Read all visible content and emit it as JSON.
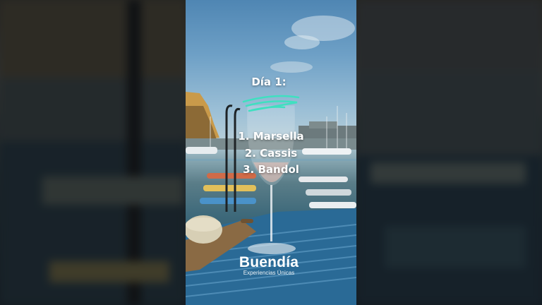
{
  "slide": {
    "title": "Día 1:",
    "stops": [
      "1. Marsella",
      "2. Cassis",
      "3. Bandol"
    ]
  },
  "brand": {
    "name": "Buendía",
    "tagline": "Experiencias Únicas"
  },
  "colors": {
    "text": "#ffffff",
    "accent_scribble": "#3fe0c0",
    "table_cloth": "#2a6a96"
  }
}
